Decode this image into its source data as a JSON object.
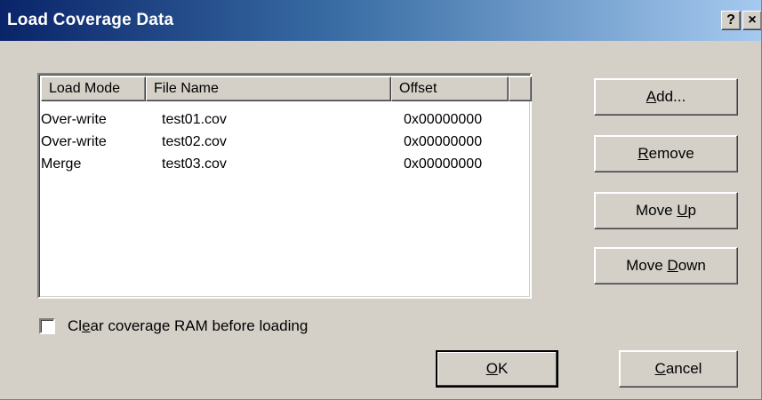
{
  "window": {
    "title": "Load Coverage Data",
    "help_glyph": "?",
    "close_glyph": "×"
  },
  "list": {
    "columns": [
      "Load Mode",
      "File Name",
      "Offset",
      ""
    ],
    "rows": [
      {
        "load_mode": "Over-write",
        "file_name": "test01.cov",
        "offset": "0x00000000"
      },
      {
        "load_mode": "Over-write",
        "file_name": "test02.cov",
        "offset": "0x00000000"
      },
      {
        "load_mode": "Merge",
        "file_name": "test03.cov",
        "offset": "0x00000000"
      }
    ]
  },
  "buttons": {
    "add": {
      "label": "Add...",
      "mnemonic": "A"
    },
    "remove": {
      "label": "Remove",
      "mnemonic": "R"
    },
    "move_up": {
      "label": "Move Up",
      "mnemonic": "U"
    },
    "move_down": {
      "label": "Move Down",
      "mnemonic": "D"
    },
    "ok": {
      "label": "OK",
      "mnemonic": "O"
    },
    "cancel": {
      "label": "Cancel",
      "mnemonic": "C"
    }
  },
  "options": {
    "clear_ram": {
      "label": "Clear coverage RAM before loading",
      "mnemonic": "e",
      "checked": false
    }
  }
}
